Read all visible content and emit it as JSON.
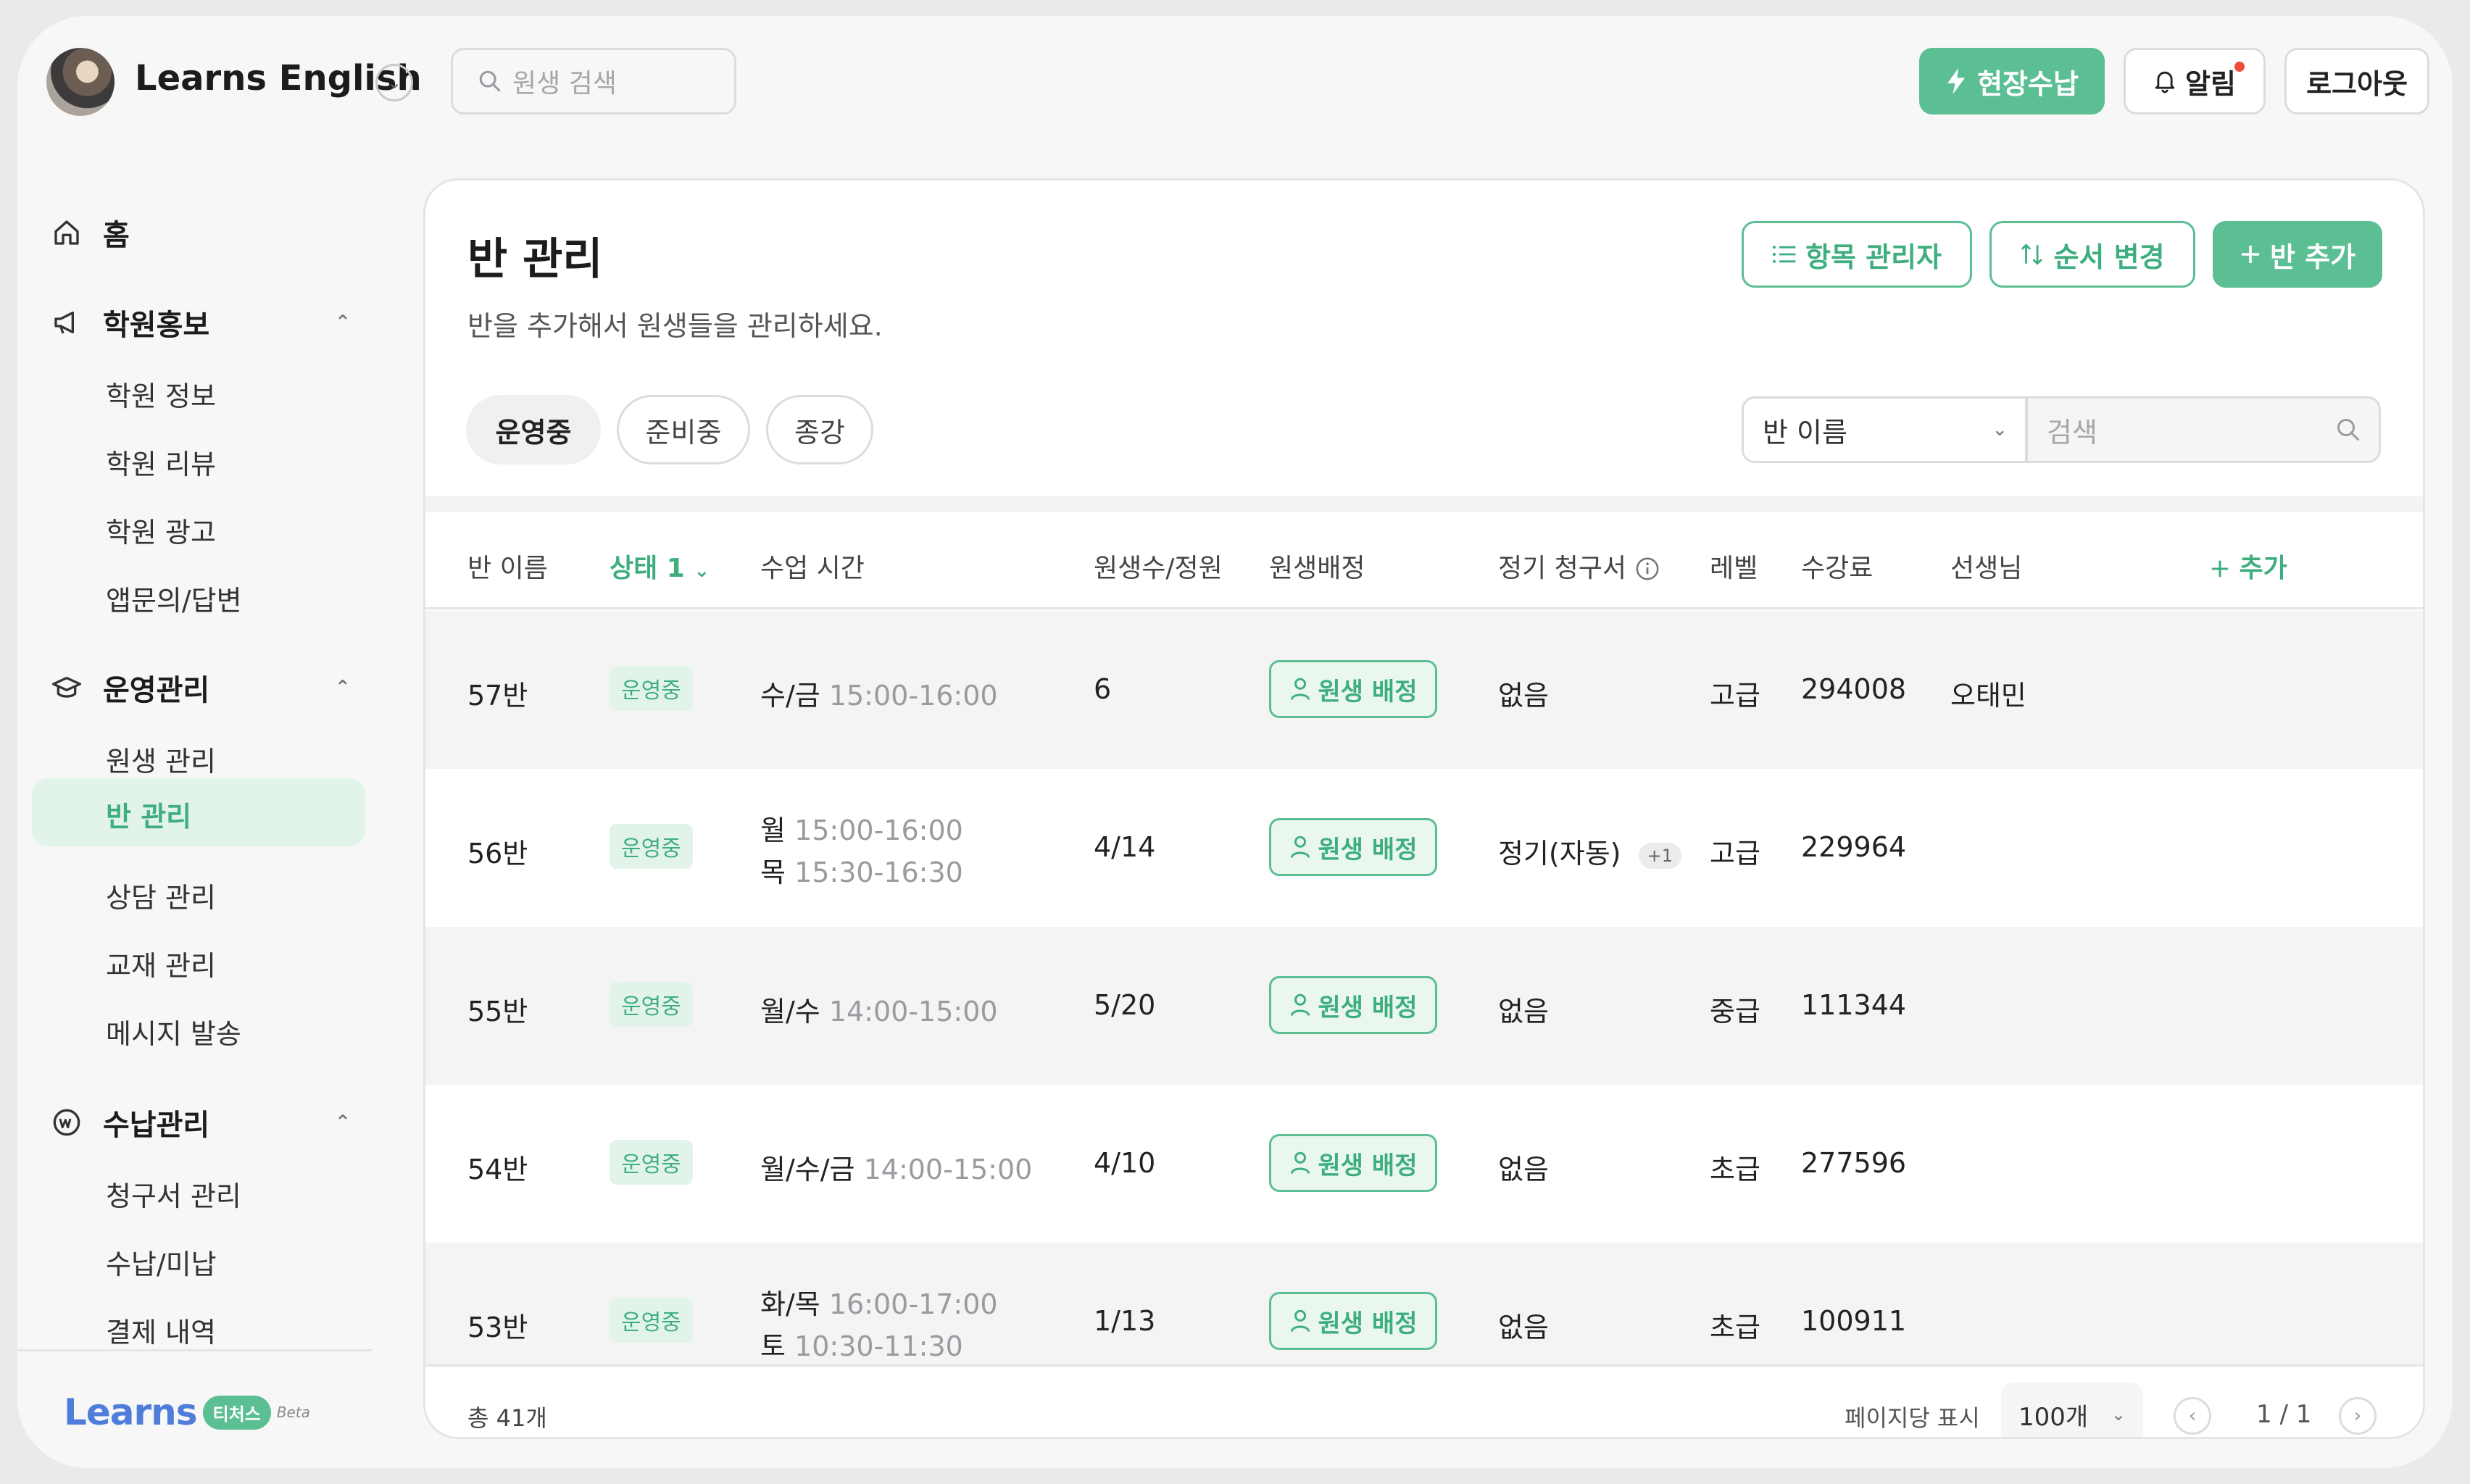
{
  "header": {
    "org_name": "Learns English",
    "search_placeholder": "원생 검색",
    "pay_button": "현장수납",
    "alarm_button": "알림",
    "logout_button": "로그아웃"
  },
  "sidebar": {
    "home": "홈",
    "groups": [
      {
        "label": "학원홍보",
        "items": [
          "학원 정보",
          "학원 리뷰",
          "학원 광고",
          "앱문의/답변"
        ]
      },
      {
        "label": "운영관리",
        "items": [
          "원생 관리",
          "반 관리",
          "상담 관리",
          "교재 관리",
          "메시지 발송"
        ]
      },
      {
        "label": "수납관리",
        "items": [
          "청구서 관리",
          "수납/미납",
          "결제 내역"
        ]
      }
    ],
    "brand": {
      "word": "Learns",
      "pill": "티처스",
      "beta": "Beta"
    }
  },
  "page": {
    "title": "반 관리",
    "subtitle": "반을 추가해서 원생들을 관리하세요.",
    "btn_items": "항목 관리자",
    "btn_order": "순서 변경",
    "btn_add": "반 추가",
    "tabs": [
      "운영중",
      "준비중",
      "종강"
    ],
    "filter_select": "반 이름",
    "search_placeholder": "검색"
  },
  "table": {
    "headers": [
      "반 이름",
      "상태 1",
      "수업 시간",
      "원생수/정원",
      "원생배정",
      "정기 청구서",
      "레벨",
      "수강료",
      "선생님",
      "추가"
    ],
    "assign_label": "원생 배정",
    "rows": [
      {
        "name": "57반",
        "status": "운영중",
        "days1": "수/금",
        "time1": "15:00-16:00",
        "days2": "",
        "time2": "",
        "count": "6",
        "invoice": "없음",
        "invoice_extra": "",
        "level": "고급",
        "fee": "294008",
        "teacher": "오태민"
      },
      {
        "name": "56반",
        "status": "운영중",
        "days1": "월",
        "time1": "15:00-16:00",
        "days2": "목",
        "time2": "15:30-16:30",
        "count": "4/14",
        "invoice": "정기(자동)",
        "invoice_extra": "+1",
        "level": "고급",
        "fee": "229964",
        "teacher": ""
      },
      {
        "name": "55반",
        "status": "운영중",
        "days1": "월/수",
        "time1": "14:00-15:00",
        "days2": "",
        "time2": "",
        "count": "5/20",
        "invoice": "없음",
        "invoice_extra": "",
        "level": "중급",
        "fee": "111344",
        "teacher": ""
      },
      {
        "name": "54반",
        "status": "운영중",
        "days1": "월/수/금",
        "time1": "14:00-15:00",
        "days2": "",
        "time2": "",
        "count": "4/10",
        "invoice": "없음",
        "invoice_extra": "",
        "level": "초급",
        "fee": "277596",
        "teacher": ""
      },
      {
        "name": "53반",
        "status": "운영중",
        "days1": "화/목",
        "time1": "16:00-17:00",
        "days2": "토",
        "time2": "10:30-11:30",
        "count": "1/13",
        "invoice": "없음",
        "invoice_extra": "",
        "level": "초급",
        "fee": "100911",
        "teacher": ""
      }
    ]
  },
  "footer": {
    "total": "총 41개",
    "per_page_label": "페이지당 표시",
    "per_page_value": "100개",
    "page_indicator": "1 / 1"
  },
  "colors": {
    "accent": "#5cbf94",
    "accent_text": "#3fae7f",
    "alert_dot": "#ef4c3a",
    "brand_blue": "#4f7dd9"
  }
}
